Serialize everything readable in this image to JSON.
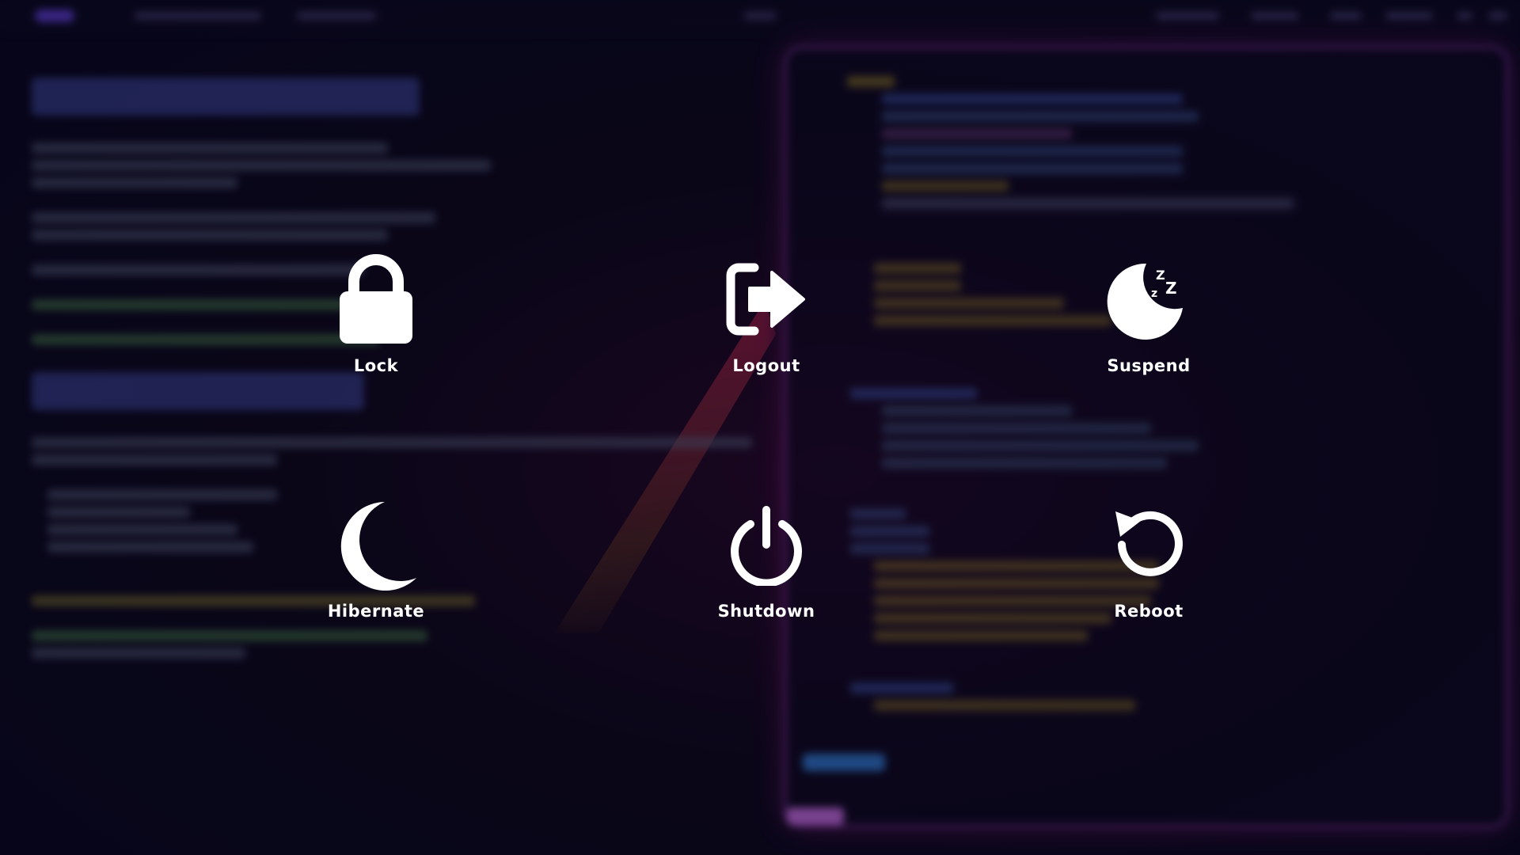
{
  "power_menu": {
    "options": [
      {
        "id": "lock",
        "label": "Lock",
        "icon": "lock-icon"
      },
      {
        "id": "logout",
        "label": "Logout",
        "icon": "logout-icon"
      },
      {
        "id": "suspend",
        "label": "Suspend",
        "icon": "suspend-icon"
      },
      {
        "id": "hibernate",
        "label": "Hibernate",
        "icon": "hibernate-icon"
      },
      {
        "id": "shutdown",
        "label": "Shutdown",
        "icon": "power-icon"
      },
      {
        "id": "reboot",
        "label": "Reboot",
        "icon": "reboot-icon"
      }
    ],
    "label_color": "#ffffff",
    "icon_color": "#ffffff"
  },
  "background": {
    "base_color": "#07051a",
    "accent_color": "#be28a0"
  }
}
